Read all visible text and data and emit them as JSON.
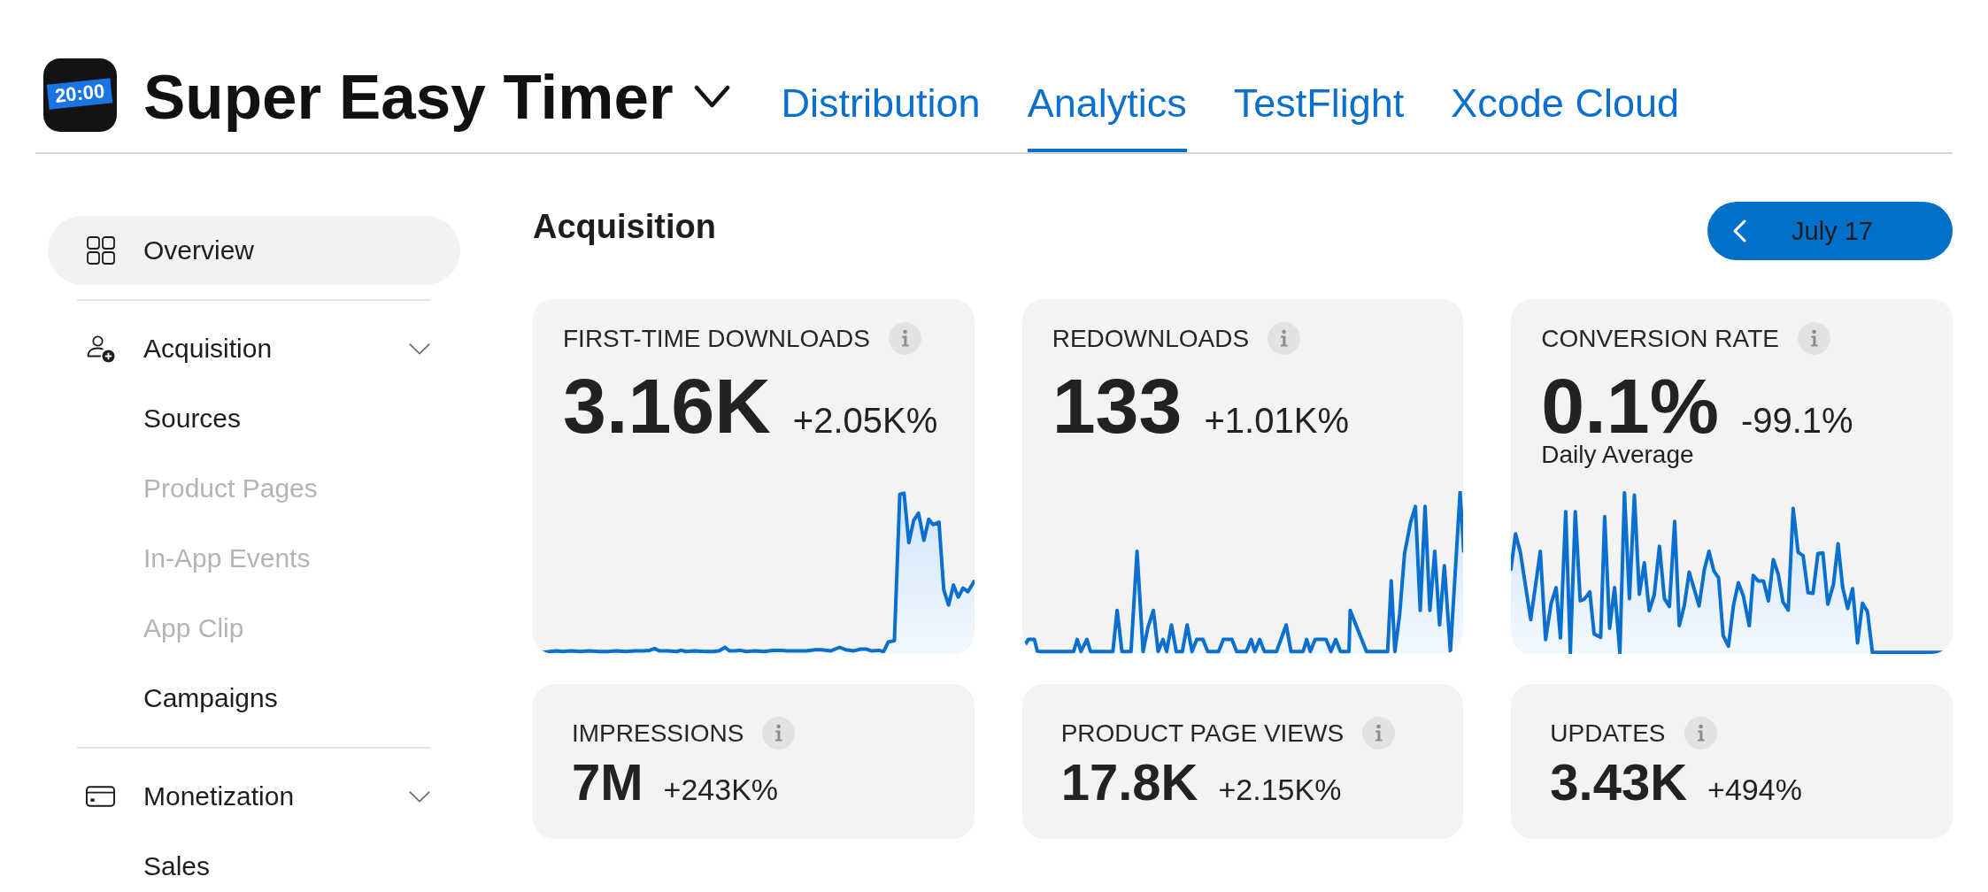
{
  "app": {
    "name": "Super Easy Timer",
    "icon_text": "20:00"
  },
  "tabs": [
    {
      "label": "Distribution",
      "selected": false
    },
    {
      "label": "Analytics",
      "selected": true
    },
    {
      "label": "TestFlight",
      "selected": false
    },
    {
      "label": "Xcode Cloud",
      "selected": false
    }
  ],
  "sidebar": {
    "items": [
      {
        "label": "Overview",
        "selected": true
      },
      {
        "label": "Acquisition",
        "selected": false,
        "expanded": true,
        "children": [
          {
            "label": "Sources",
            "selected": false,
            "disabled": false
          },
          {
            "label": "Product Pages",
            "selected": false,
            "disabled": true
          },
          {
            "label": "In-App Events",
            "selected": false,
            "disabled": true
          },
          {
            "label": "App Clip",
            "selected": false,
            "disabled": true
          },
          {
            "label": "Campaigns",
            "selected": false,
            "disabled": false
          }
        ]
      },
      {
        "label": "Monetization",
        "selected": false,
        "expanded": true,
        "children": [
          {
            "label": "Sales",
            "selected": false,
            "disabled": false
          }
        ]
      }
    ]
  },
  "main": {
    "title": "Acquisition",
    "date_button": {
      "label": "July 17"
    },
    "metrics": [
      {
        "kind": "sparkline",
        "title": "FIRST-TIME DOWNLOADS",
        "value": "3.16K",
        "change": "+2.05K%"
      },
      {
        "kind": "sparkline",
        "title": "REDOWNLOADS",
        "value": "133",
        "change": "+1.01K%"
      },
      {
        "kind": "sparkline",
        "title": "CONVERSION RATE",
        "value": "0.1%",
        "change": "-99.1%",
        "note": "Daily Average"
      },
      {
        "kind": "compact",
        "title": "IMPRESSIONS",
        "value": "7M",
        "change": "+243K%"
      },
      {
        "kind": "compact",
        "title": "PRODUCT PAGE VIEWS",
        "value": "17.8K",
        "change": "+2.15K%"
      },
      {
        "kind": "compact",
        "title": "UPDATES",
        "value": "3.43K",
        "change": "+494%"
      }
    ]
  }
}
